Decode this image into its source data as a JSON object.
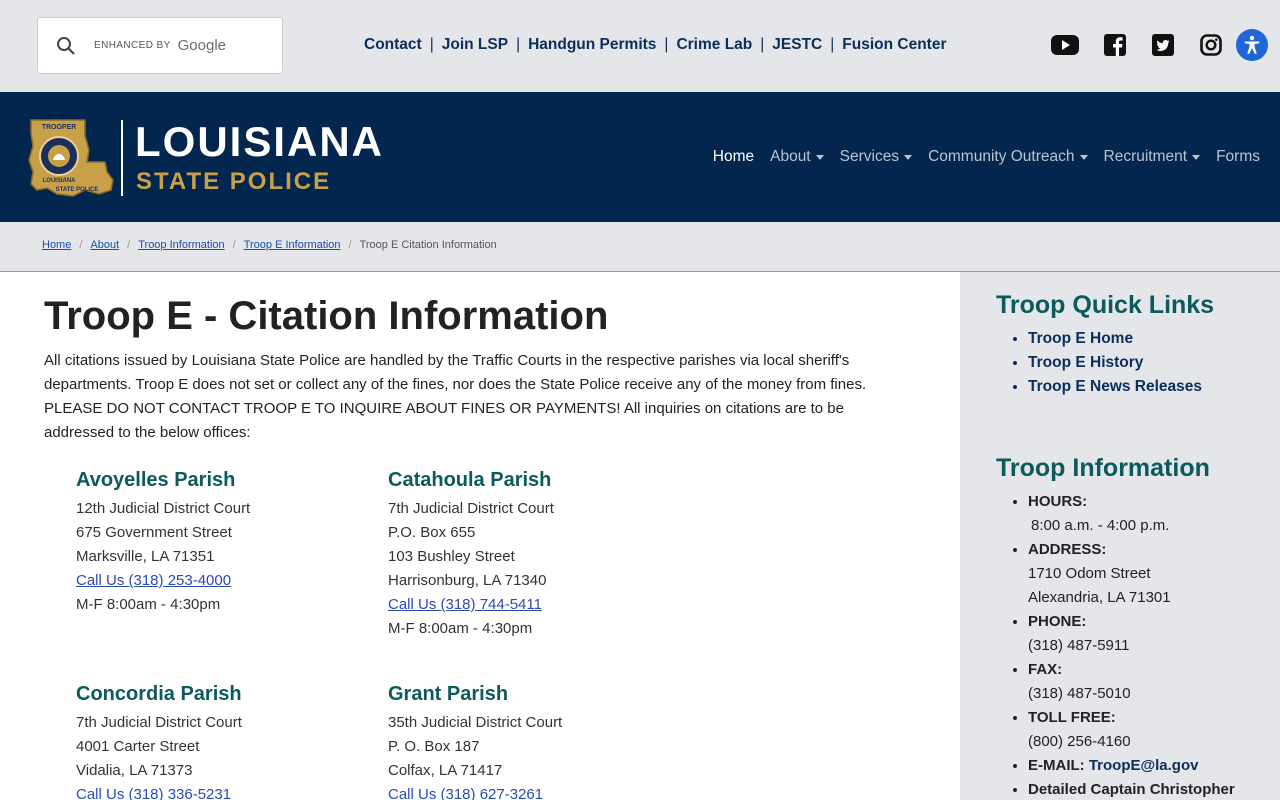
{
  "search": {
    "enhanced_label": "ENHANCED BY",
    "brand": "Google"
  },
  "top_links": [
    "Contact",
    "Join LSP",
    "Handgun Permits",
    "Crime Lab",
    "JESTC",
    "Fusion Center"
  ],
  "top_separator": "|",
  "logo": {
    "title": "LOUISIANA",
    "subtitle": "STATE POLICE",
    "badge_top": "TROOPER",
    "badge_mid": "LOUISIANA",
    "badge_bottom": "STATE POLICE"
  },
  "main_nav": [
    {
      "label": "Home",
      "dropdown": false,
      "active": true
    },
    {
      "label": "About",
      "dropdown": true,
      "active": false
    },
    {
      "label": "Services",
      "dropdown": true,
      "active": false
    },
    {
      "label": "Community Outreach",
      "dropdown": true,
      "active": false
    },
    {
      "label": "Recruitment",
      "dropdown": true,
      "active": false
    },
    {
      "label": "Forms",
      "dropdown": false,
      "active": false
    }
  ],
  "breadcrumb": {
    "links": [
      "Home",
      "About",
      "Troop Information",
      "Troop E Information"
    ],
    "current": "Troop E Citation Information",
    "separator": "/"
  },
  "page": {
    "title": "Troop E - Citation Information",
    "intro": "All citations issued by Louisiana State Police are handled by the Traffic Courts in the respective parishes via local sheriff's departments. Troop E does not set or collect any of the fines, nor does the State Police receive any of the money from fines. PLEASE DO NOT CONTACT TROOP E TO INQUIRE ABOUT FINES OR PAYMENTS! All inquiries on citations are to be addressed to the below offices:"
  },
  "parishes": [
    {
      "name": "Avoyelles Parish",
      "lines": [
        "12th Judicial District Court",
        "675 Government Street",
        "Marksville, LA 71351"
      ],
      "phone": "Call Us (318) 253-4000",
      "hours": "M-F 8:00am - 4:30pm"
    },
    {
      "name": "Catahoula Parish",
      "lines": [
        "7th Judicial District Court",
        "P.O. Box 655",
        "103 Bushley Street",
        "Harrisonburg, LA 71340"
      ],
      "phone": "Call Us (318) 744-5411",
      "hours": "M-F 8:00am - 4:30pm"
    },
    {
      "name": "Concordia Parish",
      "lines": [
        "7th Judicial District Court",
        "4001 Carter Street",
        "Vidalia, LA 71373"
      ],
      "phone": "Call Us (318) 336-5231",
      "hours": ""
    },
    {
      "name": "Grant Parish",
      "lines": [
        "35th Judicial District Court",
        "P. O. Box 187",
        "Colfax, LA 71417"
      ],
      "phone": "Call Us (318) 627-3261",
      "hours": ""
    }
  ],
  "sidebar": {
    "quick_links_title": "Troop Quick Links",
    "quick_links": [
      "Troop E Home",
      "Troop E History",
      "Troop E News Releases"
    ],
    "info_title": "Troop Information",
    "info": {
      "hours_label": "HOURS:",
      "hours_value": "8:00 a.m. - 4:00 p.m.",
      "address_label": "ADDRESS:",
      "address_line1": "1710 Odom Street",
      "address_line2": "Alexandria, LA 71301",
      "phone_label": "PHONE:",
      "phone_value": "(318) 487-5911",
      "fax_label": "FAX:",
      "fax_value": "(318) 487-5010",
      "tollfree_label": "TOLL FREE:",
      "tollfree_value": "(800) 256-4160",
      "email_label": "E-MAIL:",
      "email_value": "TroopE@la.gov",
      "captain_label": "Detailed Captain Christopher"
    }
  },
  "colors": {
    "header_bg": "#03264e",
    "top_bg": "#e4e6ea",
    "accent_gold": "#c9a04a",
    "heading_teal": "#0c5a5c",
    "link_blue": "#2a4bb0",
    "a11y_blue": "#1f66d8"
  },
  "icons": {
    "search": "search-icon",
    "youtube": "youtube-icon",
    "facebook": "facebook-icon",
    "twitter": "twitter-icon",
    "instagram": "instagram-icon",
    "accessibility": "accessibility-icon"
  }
}
